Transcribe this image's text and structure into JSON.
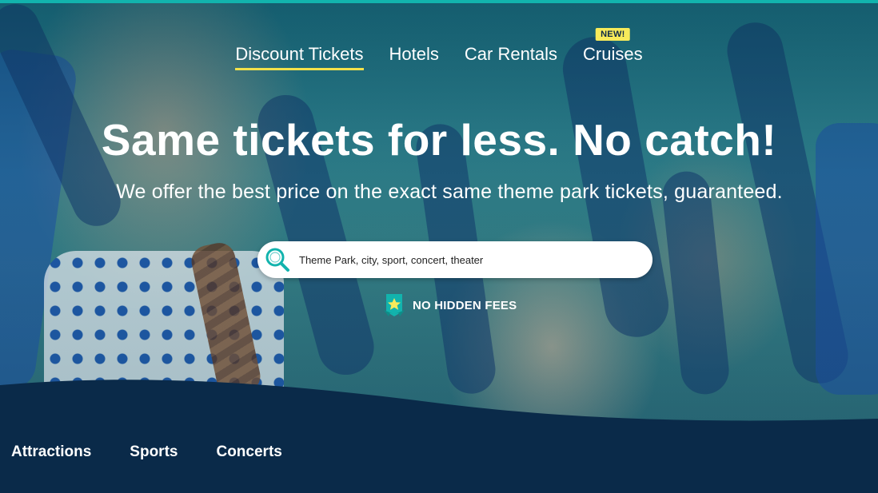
{
  "nav": {
    "items": [
      {
        "label": "Discount Tickets",
        "active": true
      },
      {
        "label": "Hotels"
      },
      {
        "label": "Car Rentals"
      },
      {
        "label": "Cruises",
        "badge": "NEW!"
      }
    ]
  },
  "hero": {
    "headline": "Same tickets for less. No catch!",
    "subheadline": "We offer the best price on the exact same theme park tickets, guaranteed."
  },
  "search": {
    "placeholder": "Theme Park, city, sport, concert, theater",
    "icon": "search-icon"
  },
  "badge": {
    "icon": "ribbon-star-icon",
    "text": "NO HIDDEN FEES"
  },
  "categories": [
    "Attractions",
    "Sports",
    "Concerts"
  ],
  "colors": {
    "accent_teal": "#12b3ad",
    "nav_underline": "#f2e14a",
    "badge_yellow": "#f7ea5a",
    "navy": "#0a2a49"
  }
}
